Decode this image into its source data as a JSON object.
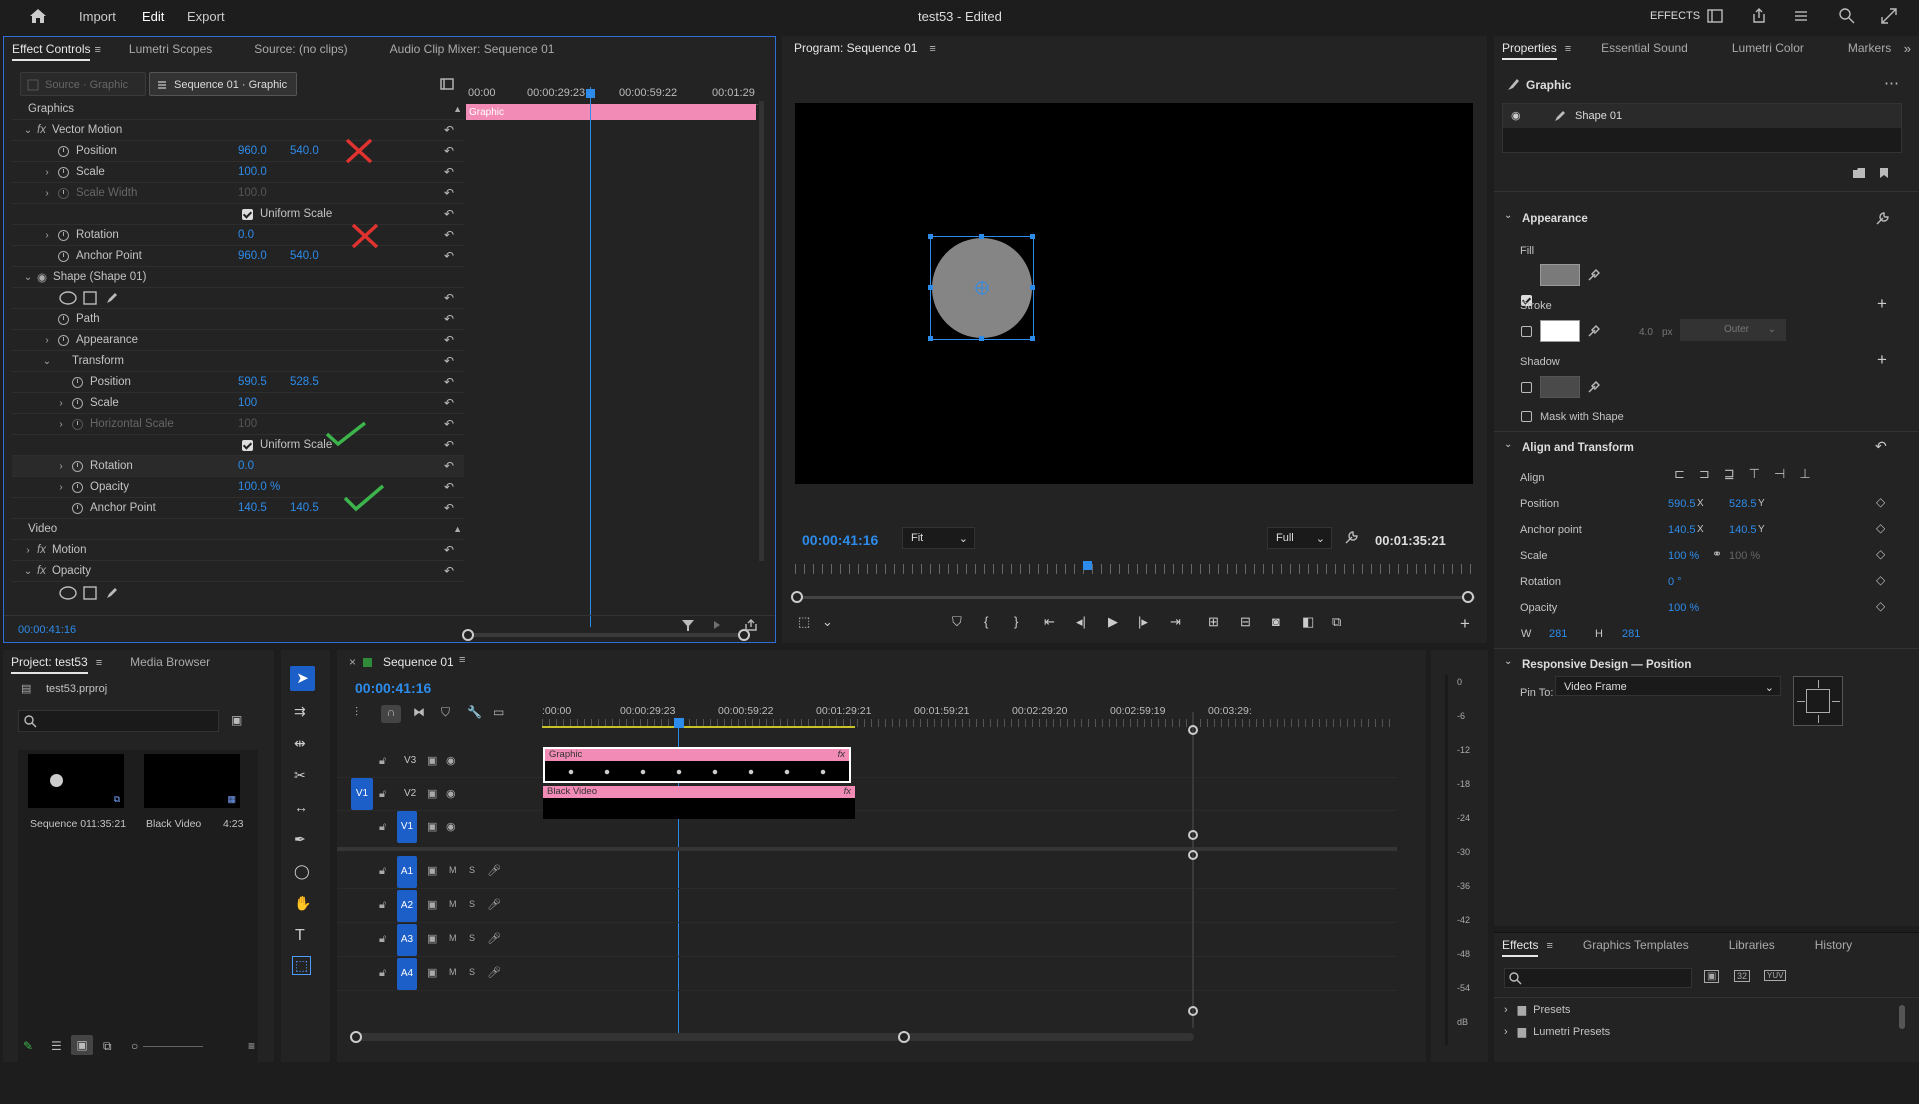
{
  "app": {
    "nav": [
      "Import",
      "Edit",
      "Export"
    ],
    "active_nav": "Edit",
    "title": "test53 - Edited",
    "workspace": "EFFECTS"
  },
  "effect_controls": {
    "tabs": [
      "Effect Controls",
      "Lumetri Scopes",
      "Source: (no clips)",
      "Audio Clip Mixer: Sequence 01"
    ],
    "source_chip": "Source · Graphic",
    "seq_chip": "Sequence 01 · Graphic",
    "timecodes": [
      "00:00",
      "00:00:29:23",
      "00:00:59:22",
      "00:01:29"
    ],
    "clip_label": "Graphic",
    "section_graphics": "Graphics",
    "vector_motion": "Vector Motion",
    "position": "Position",
    "pos_x": "960.0",
    "pos_y": "540.0",
    "scale": "Scale",
    "scale_v": "100.0",
    "scale_width": "Scale Width",
    "scale_width_v": "100.0",
    "uniform_scale": "Uniform Scale",
    "rotation": "Rotation",
    "rot_v": "0.0",
    "anchor": "Anchor Point",
    "anc_x": "960.0",
    "anc_y": "540.0",
    "shape": "Shape (Shape 01)",
    "path": "Path",
    "appearance": "Appearance",
    "transform": "Transform",
    "t_position": "Position",
    "t_pos_x": "590.5",
    "t_pos_y": "528.5",
    "t_scale": "Scale",
    "t_scale_v": "100",
    "t_hscale": "Horizontal Scale",
    "t_hscale_v": "100",
    "t_uniform": "Uniform Scale",
    "t_rotation": "Rotation",
    "t_rot_v": "0.0",
    "t_opacity": "Opacity",
    "t_opacity_v": "100.0 %",
    "t_anchor": "Anchor Point",
    "t_anc_x": "140.5",
    "t_anc_y": "140.5",
    "section_video": "Video",
    "motion": "Motion",
    "opacity": "Opacity",
    "footer_time": "00:00:41:16"
  },
  "program": {
    "tab": "Program: Sequence 01",
    "time": "00:00:41:16",
    "fit": "Fit",
    "quality": "Full",
    "duration": "00:01:35:21"
  },
  "properties": {
    "tabs": [
      "Properties",
      "Essential Sound",
      "Lumetri Color",
      "Markers"
    ],
    "header": "Graphic",
    "layer": "Shape 01",
    "appearance": "Appearance",
    "fill": "Fill",
    "stroke": "Stroke",
    "stroke_w": "4.0",
    "stroke_unit": "px",
    "stroke_type": "Outer",
    "shadow": "Shadow",
    "mask": "Mask with Shape",
    "align_transform": "Align and Transform",
    "align": "Align",
    "position": "Position",
    "pos_x": "590.5",
    "pos_x_u": "X",
    "pos_y": "528.5",
    "pos_y_u": "Y",
    "anchor": "Anchor point",
    "anc_x": "140.5",
    "anc_x_u": "X",
    "anc_y": "140.5",
    "anc_y_u": "Y",
    "scale": "Scale",
    "scale_v": "100 %",
    "scale_v2": "100 %",
    "rotation": "Rotation",
    "rot_v": "0 °",
    "opacity": "Opacity",
    "opacity_v": "100 %",
    "w_label": "W",
    "w_v": "281",
    "h_label": "H",
    "h_v": "281",
    "responsive": "Responsive Design — Position",
    "pin_to": "Pin To:",
    "pin_value": "Video Frame",
    "fill_color": "#7a7a7a",
    "stroke_color": "#ffffff"
  },
  "effects_panel": {
    "tabs": [
      "Effects",
      "Graphics Templates",
      "Libraries",
      "History"
    ],
    "items": [
      "Presets",
      "Lumetri Presets"
    ],
    "badges": [
      "32",
      "YUV"
    ]
  },
  "project": {
    "tabs": [
      "Project: test53",
      "Media Browser"
    ],
    "file": "test53.prproj",
    "items": [
      {
        "name": "Sequence 01",
        "dur": "1:35:21"
      },
      {
        "name": "Black Video",
        "dur": "4:23"
      }
    ]
  },
  "timeline": {
    "tab": "Sequence 01",
    "time": "00:00:41:16",
    "ruler": [
      ":00:00",
      "00:00:29:23",
      "00:00:59:22",
      "00:01:29:21",
      "00:01:59:21",
      "00:02:29:20",
      "00:02:59:19",
      "00:03:29:"
    ],
    "video_tracks": [
      "V3",
      "V2",
      "V1"
    ],
    "audio_tracks": [
      "A1",
      "A2",
      "A3",
      "A4"
    ],
    "src_v": "V1",
    "clips": [
      {
        "name": "Graphic",
        "fx": "fx"
      },
      {
        "name": "Black Video",
        "fx": "fx"
      }
    ],
    "m_label": "M",
    "s_label": "S",
    "meter": [
      "0",
      "-6",
      "-12",
      "-18",
      "-24",
      "-30",
      "-36",
      "-42",
      "-48",
      "-54",
      "dB"
    ]
  },
  "colors": {
    "accent": "#2d8ceb",
    "clip": "#f28bb5",
    "track_btn": "#1d5fc8",
    "red_x": "#e0322f",
    "green_check": "#3cb44b"
  }
}
